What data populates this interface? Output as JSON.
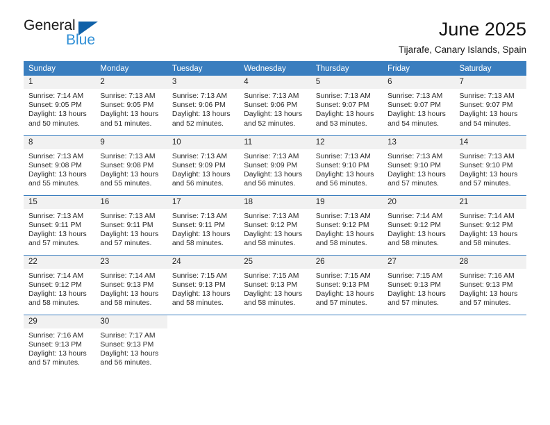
{
  "brand": {
    "name_top": "General",
    "name_bottom": "Blue",
    "color_dark": "#1a1a1a",
    "color_blue": "#2f8fd6",
    "triangle_color": "#1061a8"
  },
  "header": {
    "title": "June 2025",
    "subtitle": "Tijarafe, Canary Islands, Spain"
  },
  "theme": {
    "header_row_bg": "#3a7ebf",
    "header_row_text": "#ffffff",
    "daynum_bg": "#f1f1f1",
    "cell_bg": "#ffffff",
    "row_separator": "#3a7ebf"
  },
  "weekdays": [
    "Sunday",
    "Monday",
    "Tuesday",
    "Wednesday",
    "Thursday",
    "Friday",
    "Saturday"
  ],
  "labels": {
    "sunrise_prefix": "Sunrise:",
    "sunset_prefix": "Sunset:",
    "daylight_prefix": "Daylight:"
  },
  "weeks": [
    [
      {
        "day": "1",
        "sunrise": "Sunrise: 7:14 AM",
        "sunset": "Sunset: 9:05 PM",
        "daylight1": "Daylight: 13 hours",
        "daylight2": "and 50 minutes."
      },
      {
        "day": "2",
        "sunrise": "Sunrise: 7:13 AM",
        "sunset": "Sunset: 9:05 PM",
        "daylight1": "Daylight: 13 hours",
        "daylight2": "and 51 minutes."
      },
      {
        "day": "3",
        "sunrise": "Sunrise: 7:13 AM",
        "sunset": "Sunset: 9:06 PM",
        "daylight1": "Daylight: 13 hours",
        "daylight2": "and 52 minutes."
      },
      {
        "day": "4",
        "sunrise": "Sunrise: 7:13 AM",
        "sunset": "Sunset: 9:06 PM",
        "daylight1": "Daylight: 13 hours",
        "daylight2": "and 52 minutes."
      },
      {
        "day": "5",
        "sunrise": "Sunrise: 7:13 AM",
        "sunset": "Sunset: 9:07 PM",
        "daylight1": "Daylight: 13 hours",
        "daylight2": "and 53 minutes."
      },
      {
        "day": "6",
        "sunrise": "Sunrise: 7:13 AM",
        "sunset": "Sunset: 9:07 PM",
        "daylight1": "Daylight: 13 hours",
        "daylight2": "and 54 minutes."
      },
      {
        "day": "7",
        "sunrise": "Sunrise: 7:13 AM",
        "sunset": "Sunset: 9:07 PM",
        "daylight1": "Daylight: 13 hours",
        "daylight2": "and 54 minutes."
      }
    ],
    [
      {
        "day": "8",
        "sunrise": "Sunrise: 7:13 AM",
        "sunset": "Sunset: 9:08 PM",
        "daylight1": "Daylight: 13 hours",
        "daylight2": "and 55 minutes."
      },
      {
        "day": "9",
        "sunrise": "Sunrise: 7:13 AM",
        "sunset": "Sunset: 9:08 PM",
        "daylight1": "Daylight: 13 hours",
        "daylight2": "and 55 minutes."
      },
      {
        "day": "10",
        "sunrise": "Sunrise: 7:13 AM",
        "sunset": "Sunset: 9:09 PM",
        "daylight1": "Daylight: 13 hours",
        "daylight2": "and 56 minutes."
      },
      {
        "day": "11",
        "sunrise": "Sunrise: 7:13 AM",
        "sunset": "Sunset: 9:09 PM",
        "daylight1": "Daylight: 13 hours",
        "daylight2": "and 56 minutes."
      },
      {
        "day": "12",
        "sunrise": "Sunrise: 7:13 AM",
        "sunset": "Sunset: 9:10 PM",
        "daylight1": "Daylight: 13 hours",
        "daylight2": "and 56 minutes."
      },
      {
        "day": "13",
        "sunrise": "Sunrise: 7:13 AM",
        "sunset": "Sunset: 9:10 PM",
        "daylight1": "Daylight: 13 hours",
        "daylight2": "and 57 minutes."
      },
      {
        "day": "14",
        "sunrise": "Sunrise: 7:13 AM",
        "sunset": "Sunset: 9:10 PM",
        "daylight1": "Daylight: 13 hours",
        "daylight2": "and 57 minutes."
      }
    ],
    [
      {
        "day": "15",
        "sunrise": "Sunrise: 7:13 AM",
        "sunset": "Sunset: 9:11 PM",
        "daylight1": "Daylight: 13 hours",
        "daylight2": "and 57 minutes."
      },
      {
        "day": "16",
        "sunrise": "Sunrise: 7:13 AM",
        "sunset": "Sunset: 9:11 PM",
        "daylight1": "Daylight: 13 hours",
        "daylight2": "and 57 minutes."
      },
      {
        "day": "17",
        "sunrise": "Sunrise: 7:13 AM",
        "sunset": "Sunset: 9:11 PM",
        "daylight1": "Daylight: 13 hours",
        "daylight2": "and 58 minutes."
      },
      {
        "day": "18",
        "sunrise": "Sunrise: 7:13 AM",
        "sunset": "Sunset: 9:12 PM",
        "daylight1": "Daylight: 13 hours",
        "daylight2": "and 58 minutes."
      },
      {
        "day": "19",
        "sunrise": "Sunrise: 7:13 AM",
        "sunset": "Sunset: 9:12 PM",
        "daylight1": "Daylight: 13 hours",
        "daylight2": "and 58 minutes."
      },
      {
        "day": "20",
        "sunrise": "Sunrise: 7:14 AM",
        "sunset": "Sunset: 9:12 PM",
        "daylight1": "Daylight: 13 hours",
        "daylight2": "and 58 minutes."
      },
      {
        "day": "21",
        "sunrise": "Sunrise: 7:14 AM",
        "sunset": "Sunset: 9:12 PM",
        "daylight1": "Daylight: 13 hours",
        "daylight2": "and 58 minutes."
      }
    ],
    [
      {
        "day": "22",
        "sunrise": "Sunrise: 7:14 AM",
        "sunset": "Sunset: 9:12 PM",
        "daylight1": "Daylight: 13 hours",
        "daylight2": "and 58 minutes."
      },
      {
        "day": "23",
        "sunrise": "Sunrise: 7:14 AM",
        "sunset": "Sunset: 9:13 PM",
        "daylight1": "Daylight: 13 hours",
        "daylight2": "and 58 minutes."
      },
      {
        "day": "24",
        "sunrise": "Sunrise: 7:15 AM",
        "sunset": "Sunset: 9:13 PM",
        "daylight1": "Daylight: 13 hours",
        "daylight2": "and 58 minutes."
      },
      {
        "day": "25",
        "sunrise": "Sunrise: 7:15 AM",
        "sunset": "Sunset: 9:13 PM",
        "daylight1": "Daylight: 13 hours",
        "daylight2": "and 58 minutes."
      },
      {
        "day": "26",
        "sunrise": "Sunrise: 7:15 AM",
        "sunset": "Sunset: 9:13 PM",
        "daylight1": "Daylight: 13 hours",
        "daylight2": "and 57 minutes."
      },
      {
        "day": "27",
        "sunrise": "Sunrise: 7:15 AM",
        "sunset": "Sunset: 9:13 PM",
        "daylight1": "Daylight: 13 hours",
        "daylight2": "and 57 minutes."
      },
      {
        "day": "28",
        "sunrise": "Sunrise: 7:16 AM",
        "sunset": "Sunset: 9:13 PM",
        "daylight1": "Daylight: 13 hours",
        "daylight2": "and 57 minutes."
      }
    ],
    [
      {
        "day": "29",
        "sunrise": "Sunrise: 7:16 AM",
        "sunset": "Sunset: 9:13 PM",
        "daylight1": "Daylight: 13 hours",
        "daylight2": "and 57 minutes."
      },
      {
        "day": "30",
        "sunrise": "Sunrise: 7:17 AM",
        "sunset": "Sunset: 9:13 PM",
        "daylight1": "Daylight: 13 hours",
        "daylight2": "and 56 minutes."
      },
      {
        "day": "",
        "sunrise": "",
        "sunset": "",
        "daylight1": "",
        "daylight2": ""
      },
      {
        "day": "",
        "sunrise": "",
        "sunset": "",
        "daylight1": "",
        "daylight2": ""
      },
      {
        "day": "",
        "sunrise": "",
        "sunset": "",
        "daylight1": "",
        "daylight2": ""
      },
      {
        "day": "",
        "sunrise": "",
        "sunset": "",
        "daylight1": "",
        "daylight2": ""
      },
      {
        "day": "",
        "sunrise": "",
        "sunset": "",
        "daylight1": "",
        "daylight2": ""
      }
    ]
  ]
}
